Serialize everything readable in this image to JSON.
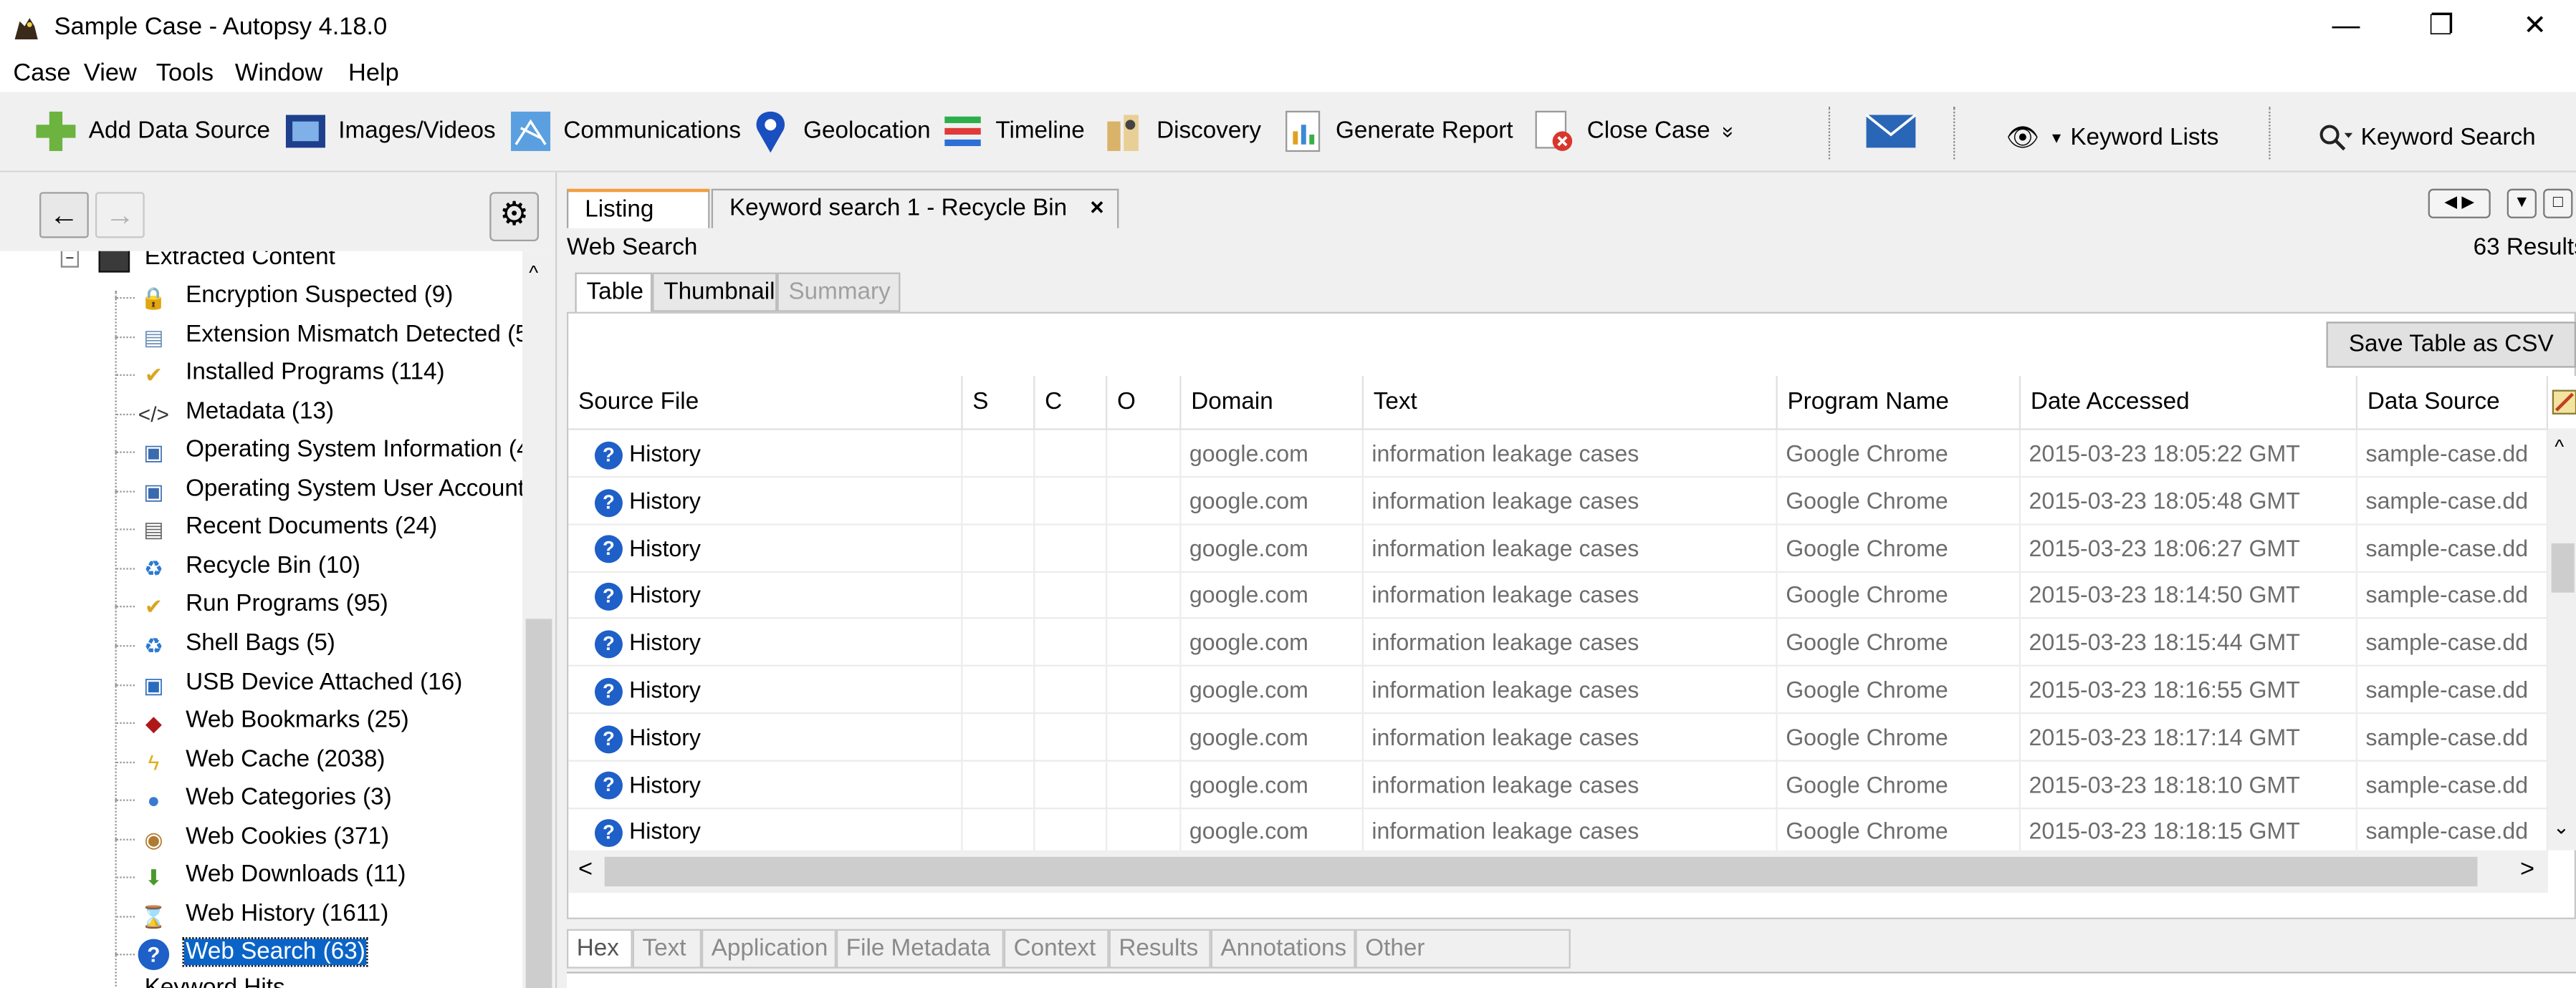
{
  "window": {
    "title": "Sample Case - Autopsy 4.18.0",
    "minimize": "—",
    "restore": "❐",
    "close": "✕"
  },
  "menu": [
    "Case",
    "View",
    "Tools",
    "Window",
    "Help"
  ],
  "toolbar": {
    "add_data_source": "Add Data Source",
    "images_videos": "Images/Videos",
    "communications": "Communications",
    "geolocation": "Geolocation",
    "timeline": "Timeline",
    "discovery": "Discovery",
    "generate_report": "Generate Report",
    "close_case": "Close Case",
    "more": "»",
    "keyword_lists": "Keyword Lists",
    "keyword_search": "Keyword Search"
  },
  "tree": {
    "parent": "Extracted Content",
    "items": [
      {
        "label": "Encryption Suspected (9)",
        "icon": "encryption-icon"
      },
      {
        "label": "Extension Mismatch Detected (5",
        "icon": "mismatch-icon"
      },
      {
        "label": "Installed Programs (114)",
        "icon": "programs-icon"
      },
      {
        "label": "Metadata (13)",
        "icon": "metadata-icon"
      },
      {
        "label": "Operating System Information (4",
        "icon": "os-info-icon"
      },
      {
        "label": "Operating System User Account",
        "icon": "os-user-icon"
      },
      {
        "label": "Recent Documents (24)",
        "icon": "recent-docs-icon"
      },
      {
        "label": "Recycle Bin (10)",
        "icon": "recycle-icon"
      },
      {
        "label": "Run Programs (95)",
        "icon": "run-icon"
      },
      {
        "label": "Shell Bags (5)",
        "icon": "shellbags-icon"
      },
      {
        "label": "USB Device Attached (16)",
        "icon": "usb-icon"
      },
      {
        "label": "Web Bookmarks (25)",
        "icon": "bookmark-icon"
      },
      {
        "label": "Web Cache (2038)",
        "icon": "cache-icon"
      },
      {
        "label": "Web Categories (3)",
        "icon": "categories-icon"
      },
      {
        "label": "Web Cookies (371)",
        "icon": "cookie-icon"
      },
      {
        "label": "Web Downloads (11)",
        "icon": "download-icon"
      },
      {
        "label": "Web History (1611)",
        "icon": "hourglass-icon"
      },
      {
        "label": "Web Search (63)",
        "icon": "web-search-icon"
      }
    ],
    "next_parent": "Keyword Hits"
  },
  "tabs": {
    "listing": "Listing",
    "keyword_tab": "Keyword search 1 - Recycle Bin",
    "close": "×"
  },
  "view": {
    "title": "Web Search",
    "results": "63  Results",
    "subtabs": [
      "Table",
      "Thumbnail",
      "Summary"
    ],
    "save_csv": "Save Table as CSV"
  },
  "table": {
    "columns": [
      "Source File",
      "S",
      "C",
      "O",
      "Domain",
      "Text",
      "Program Name",
      "Date Accessed",
      "Data Source"
    ],
    "rows": [
      [
        "History",
        "",
        "",
        "",
        "google.com",
        "information leakage cases",
        "Google Chrome",
        "2015-03-23 18:05:22 GMT",
        "sample-case.dd"
      ],
      [
        "History",
        "",
        "",
        "",
        "google.com",
        "information leakage cases",
        "Google Chrome",
        "2015-03-23 18:05:48 GMT",
        "sample-case.dd"
      ],
      [
        "History",
        "",
        "",
        "",
        "google.com",
        "information leakage cases",
        "Google Chrome",
        "2015-03-23 18:06:27 GMT",
        "sample-case.dd"
      ],
      [
        "History",
        "",
        "",
        "",
        "google.com",
        "information leakage cases",
        "Google Chrome",
        "2015-03-23 18:14:50 GMT",
        "sample-case.dd"
      ],
      [
        "History",
        "",
        "",
        "",
        "google.com",
        "information leakage cases",
        "Google Chrome",
        "2015-03-23 18:15:44 GMT",
        "sample-case.dd"
      ],
      [
        "History",
        "",
        "",
        "",
        "google.com",
        "information leakage cases",
        "Google Chrome",
        "2015-03-23 18:16:55 GMT",
        "sample-case.dd"
      ],
      [
        "History",
        "",
        "",
        "",
        "google.com",
        "information leakage cases",
        "Google Chrome",
        "2015-03-23 18:17:14 GMT",
        "sample-case.dd"
      ],
      [
        "History",
        "",
        "",
        "",
        "google.com",
        "information leakage cases",
        "Google Chrome",
        "2015-03-23 18:18:10 GMT",
        "sample-case.dd"
      ],
      [
        "History",
        "",
        "",
        "",
        "google.com",
        "information leakage cases",
        "Google Chrome",
        "2015-03-23 18:18:15 GMT",
        "sample-case.dd"
      ]
    ]
  },
  "bottom_tabs": [
    "Hex",
    "Text",
    "Application",
    "File Metadata",
    "Context",
    "Results",
    "Annotations",
    "Other Occurrences"
  ]
}
